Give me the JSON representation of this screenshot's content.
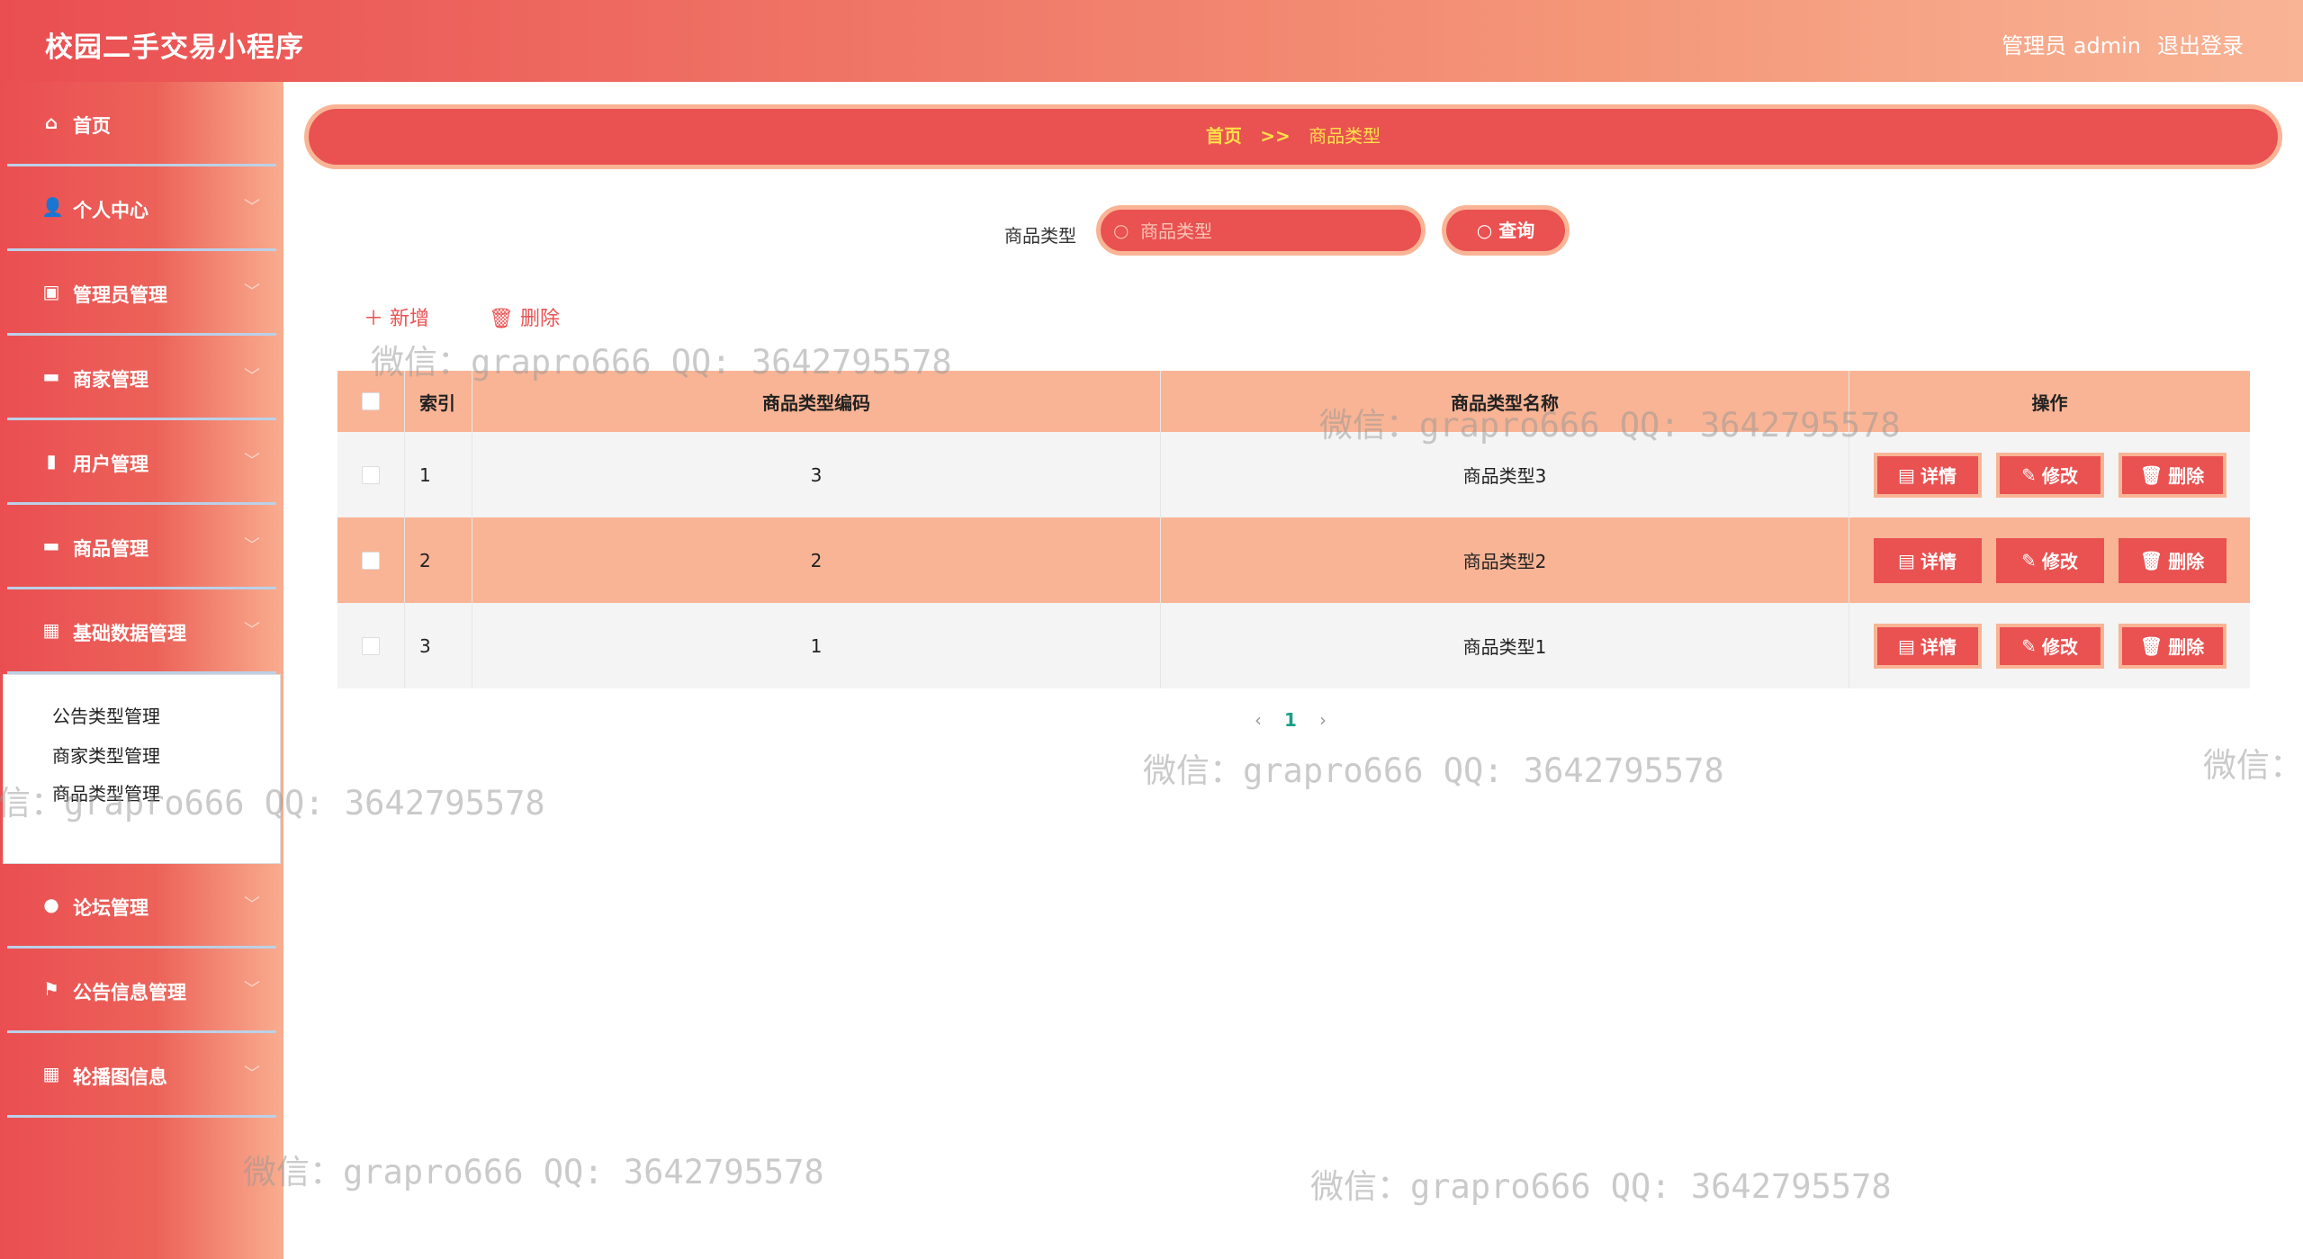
{
  "header": {
    "title": "校园二手交易小程序",
    "user": "管理员 admin",
    "logout": "退出登录"
  },
  "sidebar": {
    "items": [
      {
        "label": "首页",
        "icon": "home-icon",
        "glyph": "⌂",
        "chevron": false
      },
      {
        "label": "个人中心",
        "icon": "user-icon",
        "glyph": "👤",
        "chevron": true
      },
      {
        "label": "管理员管理",
        "icon": "admin-icon",
        "glyph": "▣",
        "chevron": true
      },
      {
        "label": "商家管理",
        "icon": "chat-icon",
        "glyph": "▬",
        "chevron": true
      },
      {
        "label": "用户管理",
        "icon": "users-icon",
        "glyph": "▮",
        "chevron": true
      },
      {
        "label": "商品管理",
        "icon": "goods-icon",
        "glyph": "▬",
        "chevron": true
      },
      {
        "label": "基础数据管理",
        "icon": "grid-icon",
        "glyph": "▦",
        "chevron": true
      }
    ],
    "submenu": [
      "公告类型管理",
      "商家类型管理",
      "商品类型管理"
    ],
    "items_after": [
      {
        "label": "论坛管理",
        "icon": "location-icon",
        "glyph": "●",
        "chevron": true
      },
      {
        "label": "公告信息管理",
        "icon": "flag-icon",
        "glyph": "⚑",
        "chevron": true
      },
      {
        "label": "轮播图信息",
        "icon": "grid-icon",
        "glyph": "▦",
        "chevron": true
      }
    ]
  },
  "breadcrumb": {
    "home": "首页",
    "sep": ">>",
    "current": "商品类型"
  },
  "search": {
    "label": "商品类型",
    "placeholder": "商品类型",
    "button": "查询"
  },
  "toolbar": {
    "add": "新增",
    "delete": "删除"
  },
  "table": {
    "headers": {
      "index": "索引",
      "code": "商品类型编码",
      "name": "商品类型名称",
      "ops": "操作"
    },
    "rows": [
      {
        "index": "1",
        "code": "3",
        "name": "商品类型3"
      },
      {
        "index": "2",
        "code": "2",
        "name": "商品类型2"
      },
      {
        "index": "3",
        "code": "1",
        "name": "商品类型1"
      }
    ],
    "op_labels": {
      "detail": "详情",
      "edit": "修改",
      "delete": "删除"
    }
  },
  "pagination": {
    "current": "1"
  },
  "watermark": "微信：grapro666 QQ: 3642795578",
  "colors": {
    "primary": "#ea5151",
    "accent": "#f9b495",
    "crumb": "#ffe14a",
    "page_active": "#17a085"
  }
}
